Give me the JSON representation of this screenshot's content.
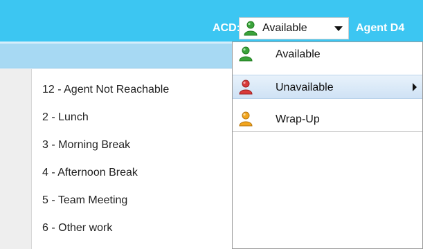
{
  "header": {
    "acd_label": "ACD:",
    "status_selector": {
      "value": "Available",
      "icon": "user-green-icon"
    },
    "agent_label": "Agent D4"
  },
  "status_menu": {
    "items": [
      {
        "label": "Available",
        "icon": "user-green-icon",
        "color": "#3aa33a",
        "has_submenu": false
      },
      {
        "label": "Unavailable",
        "icon": "user-red-icon",
        "color": "#d93a3a",
        "has_submenu": true,
        "highlighted": true
      },
      {
        "label": "Wrap-Up",
        "icon": "user-orange-icon",
        "color": "#f2a51e",
        "has_submenu": false
      }
    ]
  },
  "reasons_menu": {
    "items": [
      {
        "label": "12 - Agent Not Reachable"
      },
      {
        "label": "2 - Lunch"
      },
      {
        "label": "3 - Morning Break"
      },
      {
        "label": "4 - Afternoon Break"
      },
      {
        "label": "5 - Team Meeting"
      },
      {
        "label": "6 - Other work"
      }
    ]
  },
  "colors": {
    "header_bg": "#3cc6f2",
    "subbar_bg": "#a7d9f3",
    "highlight_bg": "#cfe2f5"
  }
}
